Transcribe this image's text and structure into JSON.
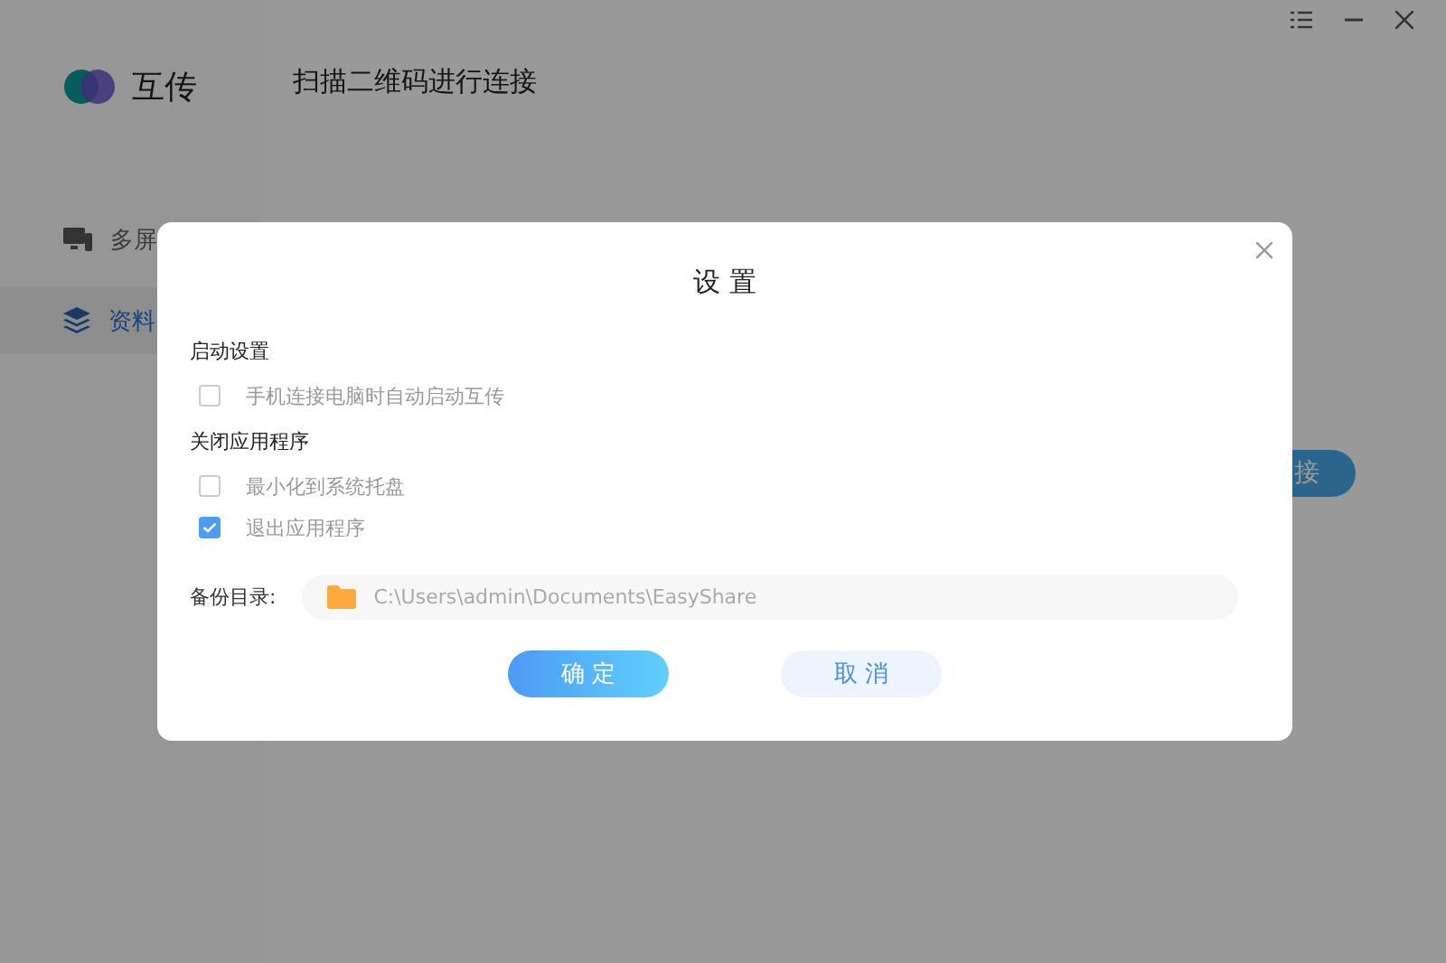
{
  "app": {
    "name": "互传",
    "heading": "扫描二维码进行连接"
  },
  "sidebar": {
    "items": [
      {
        "label": "多屏",
        "selected": false
      },
      {
        "label": "资料",
        "selected": true
      }
    ]
  },
  "background_button": {
    "label": "接"
  },
  "dialog": {
    "title": "设 置",
    "sections": [
      {
        "title": "启动设置",
        "options": [
          {
            "label": "手机连接电脑时自动启动互传",
            "checked": false
          }
        ]
      },
      {
        "title": "关闭应用程序",
        "options": [
          {
            "label": "最小化到系统托盘",
            "checked": false
          },
          {
            "label": "退出应用程序",
            "checked": true
          }
        ]
      }
    ],
    "backup": {
      "label": "备份目录:",
      "value": "C:\\Users\\admin\\Documents\\EasyShare"
    },
    "buttons": [
      {
        "label": "确 定",
        "kind": "primary"
      },
      {
        "label": "取 消",
        "kind": "secondary"
      }
    ]
  }
}
